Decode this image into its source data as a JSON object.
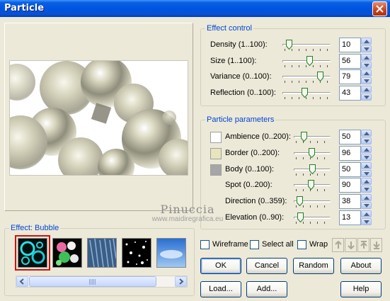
{
  "window": {
    "title": "Particle"
  },
  "watermark": {
    "name": "Pinuccia",
    "url": "www.maidiregrafica.eu"
  },
  "effect_control": {
    "title": "Effect control",
    "rows": [
      {
        "label": "Density (1..100):",
        "value": "10",
        "level": 0.1
      },
      {
        "label": "Size (1..100):",
        "value": "56",
        "level": 0.56
      },
      {
        "label": "Variance (0..100):",
        "value": "79",
        "level": 0.79
      },
      {
        "label": "Reflection (0..100):",
        "value": "43",
        "level": 0.43
      }
    ]
  },
  "particle_parameters": {
    "title": "Particle parameters",
    "rows": [
      {
        "label": "Ambience (0..200):",
        "value": "50",
        "level": 0.25,
        "swatch": "#ffffff"
      },
      {
        "label": "Border (0..200):",
        "value": "96",
        "level": 0.48,
        "swatch": "#e8e4be"
      },
      {
        "label": "Body (0..100):",
        "value": "50",
        "level": 0.5,
        "swatch": "#a6a6a6"
      },
      {
        "label": "Spot (0..200):",
        "value": "90",
        "level": 0.45
      },
      {
        "label": "Direction (0..359):",
        "value": "38",
        "level": 0.11
      },
      {
        "label": "Elevation (0..90):",
        "value": "13",
        "level": 0.14
      }
    ]
  },
  "effect": {
    "title": "Effect: Bubble",
    "thumbnails": [
      "bubble",
      "spheres",
      "rain",
      "stars",
      "sky"
    ],
    "selected_index": 0
  },
  "options": {
    "wireframe": "Wireframe",
    "select_all": "Select all",
    "wrap": "Wrap"
  },
  "arrows": [
    "up-icon",
    "down-icon",
    "top-icon",
    "bottom-icon"
  ],
  "buttons": {
    "ok": "OK",
    "cancel": "Cancel",
    "random": "Random",
    "about": "About",
    "load": "Load...",
    "add": "Add...",
    "help": "Help"
  },
  "colors": {
    "title_bar": "#0054e3",
    "group_title": "#0046d5",
    "selected_outline": "#d01010"
  }
}
